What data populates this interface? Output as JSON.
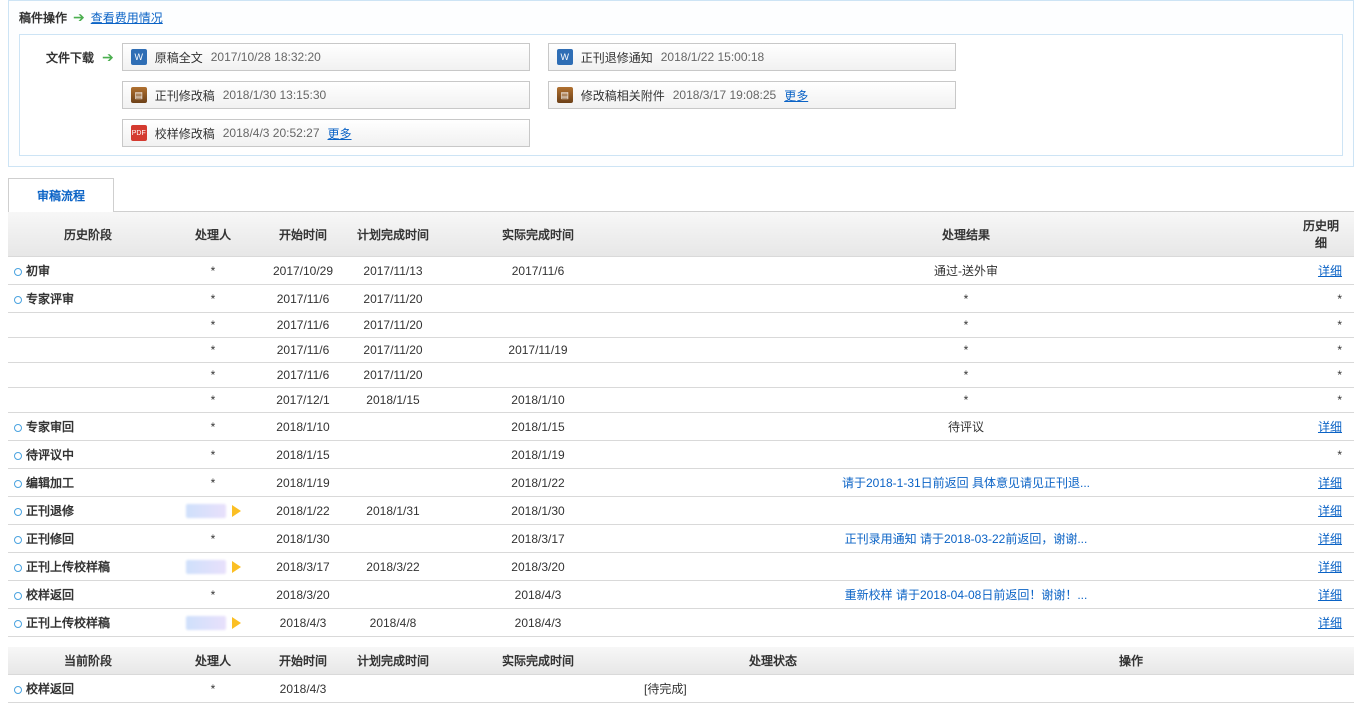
{
  "ops": {
    "label": "稿件操作",
    "view_fees": "查看费用情况"
  },
  "downloads": {
    "label": "文件下载",
    "more": "更多",
    "col_left": [
      {
        "icon": "doc",
        "name": "原稿全文",
        "ts": "2017/10/28 18:32:20",
        "more": false
      },
      {
        "icon": "zip",
        "name": "正刊修改稿",
        "ts": "2018/1/30 13:15:30",
        "more": false
      },
      {
        "icon": "pdf",
        "name": "校样修改稿",
        "ts": "2018/4/3 20:52:27",
        "more": true
      }
    ],
    "col_right": [
      {
        "icon": "doc",
        "name": "正刊退修通知",
        "ts": "2018/1/22 15:00:18",
        "more": false
      },
      {
        "icon": "zip",
        "name": "修改稿相关附件",
        "ts": "2018/3/17 19:08:25",
        "more": true
      }
    ]
  },
  "tabs": {
    "review_process": "审稿流程"
  },
  "history": {
    "headers": {
      "phase": "历史阶段",
      "handler": "处理人",
      "start": "开始时间",
      "plan": "计划完成时间",
      "actual": "实际完成时间",
      "result": "处理结果",
      "detail": "历史明细"
    },
    "detail_link": "详细",
    "rows": [
      {
        "phase": "初审",
        "show_phase": true,
        "handler": "*",
        "start": "2017/10/29",
        "plan": "2017/11/13",
        "actual": "2017/11/6",
        "result": "通过-送外审",
        "result_link": false,
        "detail": "link"
      },
      {
        "phase": "专家评审",
        "show_phase": true,
        "handler": "*",
        "start": "2017/11/6",
        "plan": "2017/11/20",
        "actual": "",
        "result": "*",
        "result_link": false,
        "detail": "*"
      },
      {
        "phase": "",
        "show_phase": false,
        "handler": "*",
        "start": "2017/11/6",
        "plan": "2017/11/20",
        "actual": "",
        "result": "*",
        "result_link": false,
        "detail": "*"
      },
      {
        "phase": "",
        "show_phase": false,
        "handler": "*",
        "start": "2017/11/6",
        "plan": "2017/11/20",
        "actual": "2017/11/19",
        "result": "*",
        "result_link": false,
        "detail": "*"
      },
      {
        "phase": "",
        "show_phase": false,
        "handler": "*",
        "start": "2017/11/6",
        "plan": "2017/11/20",
        "actual": "",
        "result": "*",
        "result_link": false,
        "detail": "*"
      },
      {
        "phase": "",
        "show_phase": false,
        "handler": "*",
        "start": "2017/12/1",
        "plan": "2018/1/15",
        "actual": "2018/1/10",
        "result": "*",
        "result_link": false,
        "detail": "*"
      },
      {
        "phase": "专家审回",
        "show_phase": true,
        "handler": "*",
        "start": "2018/1/10",
        "plan": "",
        "actual": "2018/1/15",
        "result": "待评议",
        "result_link": false,
        "detail": "link"
      },
      {
        "phase": "待评议中",
        "show_phase": true,
        "handler": "*",
        "start": "2018/1/15",
        "plan": "",
        "actual": "2018/1/19",
        "result": "",
        "result_link": false,
        "detail": "*"
      },
      {
        "phase": "编辑加工",
        "show_phase": true,
        "handler": "*",
        "start": "2018/1/19",
        "plan": "",
        "actual": "2018/1/22",
        "result": "请于2018-1-31日前返回 具体意见请见正刊退...",
        "result_link": true,
        "detail": "link"
      },
      {
        "phase": "正刊退修",
        "show_phase": true,
        "handler": "blur",
        "start": "2018/1/22",
        "plan": "2018/1/31",
        "actual": "2018/1/30",
        "result": "",
        "result_link": false,
        "detail": "link"
      },
      {
        "phase": "正刊修回",
        "show_phase": true,
        "handler": "*",
        "start": "2018/1/30",
        "plan": "",
        "actual": "2018/3/17",
        "result": "正刊录用通知 请于2018-03-22前返回，谢谢...",
        "result_link": true,
        "detail": "link"
      },
      {
        "phase": "正刊上传校样稿",
        "show_phase": true,
        "handler": "blur",
        "start": "2018/3/17",
        "plan": "2018/3/22",
        "actual": "2018/3/20",
        "result": "",
        "result_link": false,
        "detail": "link"
      },
      {
        "phase": "校样返回",
        "show_phase": true,
        "handler": "*",
        "start": "2018/3/20",
        "plan": "",
        "actual": "2018/4/3",
        "result": "重新校样 请于2018-04-08日前返回！谢谢！...",
        "result_link": true,
        "detail": "link"
      },
      {
        "phase": "正刊上传校样稿",
        "show_phase": true,
        "handler": "blur",
        "start": "2018/4/3",
        "plan": "2018/4/8",
        "actual": "2018/4/3",
        "result": "",
        "result_link": false,
        "detail": "link"
      }
    ]
  },
  "current": {
    "headers": {
      "phase": "当前阶段",
      "handler": "处理人",
      "start": "开始时间",
      "plan": "计划完成时间",
      "actual": "实际完成时间",
      "status": "处理状态",
      "action": "操作"
    },
    "row": {
      "phase": "校样返回",
      "handler": "*",
      "start": "2018/4/3",
      "plan": "",
      "actual": "",
      "status": "[待完成]",
      "action": ""
    }
  }
}
